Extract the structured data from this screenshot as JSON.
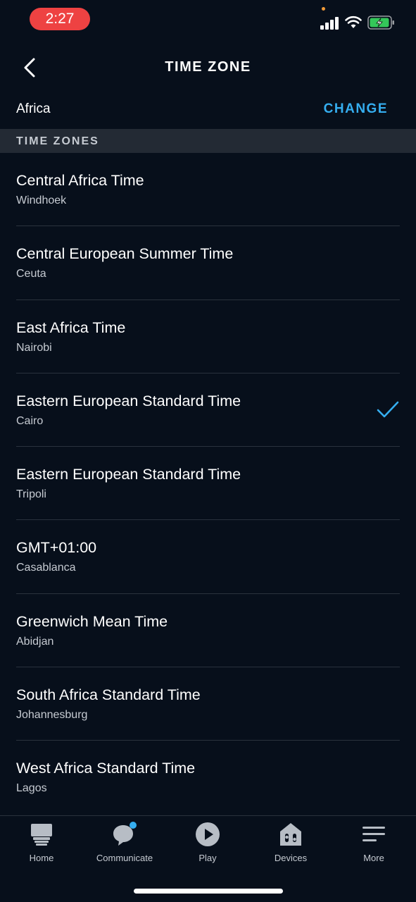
{
  "status_bar": {
    "time": "2:27",
    "icons": [
      "signal-icon",
      "wifi-icon",
      "battery-charging-icon"
    ],
    "colors": {
      "time_pill": "#ee4242",
      "battery": "#34c759",
      "indicator_dot": "#f19a37"
    }
  },
  "header": {
    "title": "TIME ZONE",
    "back_icon": "chevron-left-icon"
  },
  "region": {
    "value": "Africa",
    "change_label": "CHANGE"
  },
  "section": {
    "label": "TIME ZONES"
  },
  "time_zones": [
    {
      "name": "Central Africa Time",
      "city": "Windhoek",
      "selected": false
    },
    {
      "name": "Central European Summer Time",
      "city": "Ceuta",
      "selected": false
    },
    {
      "name": "East Africa Time",
      "city": "Nairobi",
      "selected": false
    },
    {
      "name": "Eastern European Standard Time",
      "city": "Cairo",
      "selected": true
    },
    {
      "name": "Eastern European Standard Time",
      "city": "Tripoli",
      "selected": false
    },
    {
      "name": "GMT+01:00",
      "city": "Casablanca",
      "selected": false
    },
    {
      "name": "Greenwich Mean Time",
      "city": "Abidjan",
      "selected": false
    },
    {
      "name": "South Africa Standard Time",
      "city": "Johannesburg",
      "selected": false
    },
    {
      "name": "West Africa Standard Time",
      "city": "Lagos",
      "selected": false
    }
  ],
  "tab_bar": {
    "tabs": [
      {
        "label": "Home",
        "icon": "home-icon"
      },
      {
        "label": "Communicate",
        "icon": "chat-bubble-icon",
        "badge": true
      },
      {
        "label": "Play",
        "icon": "play-icon"
      },
      {
        "label": "Devices",
        "icon": "devices-icon"
      },
      {
        "label": "More",
        "icon": "menu-icon"
      }
    ]
  },
  "theme": {
    "background": "#070f1b",
    "accent": "#35aef0",
    "section_bg": "#232a34",
    "muted_text": "#c6cbd2",
    "icon_gray": "#b7bdc5"
  }
}
